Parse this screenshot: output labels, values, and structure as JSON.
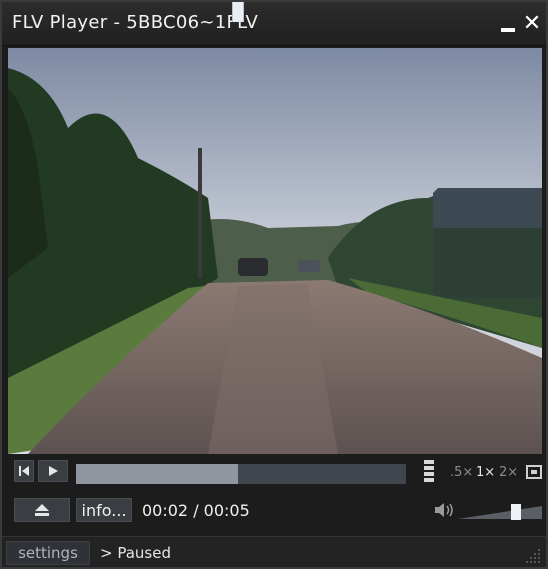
{
  "window": {
    "title": "FLV Player - 5BBC06~1FLV"
  },
  "controls": {
    "progress": 0.49,
    "zoom_options": [
      ".5×",
      "1×",
      "2×"
    ],
    "active_zoom": "1×",
    "info_label": "info...",
    "time_display": "00:02 / 00:05",
    "volume": 0.75
  },
  "statusbar": {
    "settings_label": "settings",
    "status_text": "> Paused"
  },
  "icons": {
    "minimize": "minimize-icon",
    "close": "close-icon",
    "previous": "skip-previous-icon",
    "play": "play-icon",
    "eject": "eject-icon",
    "buffer": "buffer-level-icon",
    "fullscreen": "fullscreen-icon",
    "volume": "speaker-icon",
    "resize": "resize-grip-icon"
  },
  "colors": {
    "window_bg": "#1c1c1c",
    "button_bg": "#3a3d42",
    "seek_track": "#41454e",
    "seek_fill": "#8f969f",
    "knob": "#e9eef3"
  }
}
